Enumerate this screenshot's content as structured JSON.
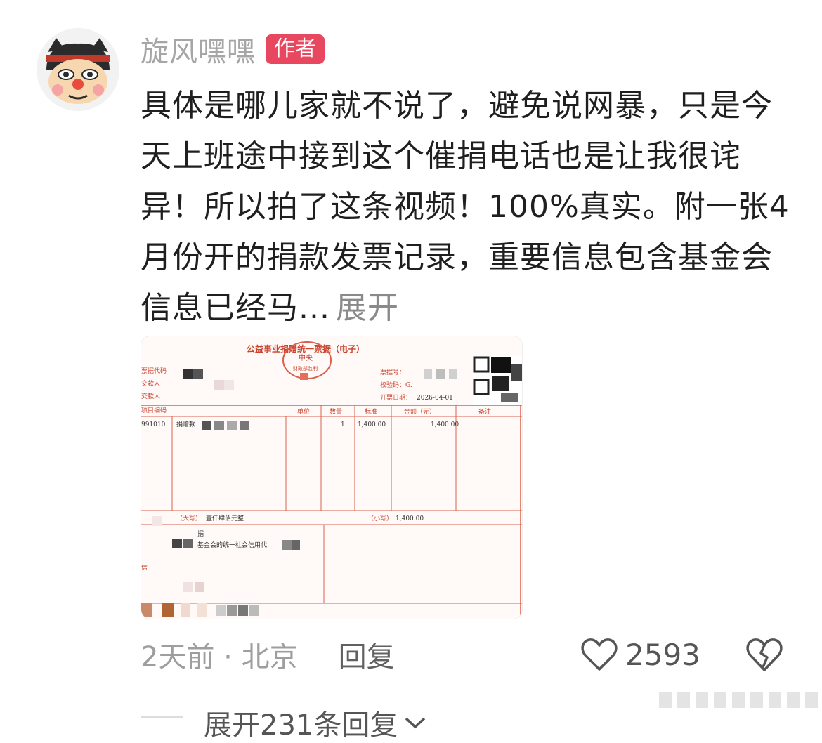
{
  "comment": {
    "username": "旋风嘿嘿",
    "author_badge": "作者",
    "text": "具体是哪儿家就不说了，避免说网暴，只是今天上班途中接到这个催捐电话也是让我很诧异！所以拍了这条视频！100%真实。附一张4月份开的捐款发票记录，重要信息包含基金会信息已经马...",
    "expand_label": "展开",
    "time_location": "2天前 · 北京",
    "reply_label": "回复",
    "like_count": "2593",
    "avatar_icon": "cartoon-mask-avatar"
  },
  "invoice": {
    "title": "公益事业捐赠统一票据（电子）",
    "seal_text": "中央",
    "seal_sub": "财政部监制",
    "left_labels": [
      "票据代码",
      "交款人",
      "交款人",
      "项目编码"
    ],
    "receipt_no_label": "票据号：",
    "check_code_label": "校验码：G.",
    "issue_date_label": "开票日期：",
    "issue_date": "2026-04-01",
    "col_qty": "数量",
    "col_std": "标准",
    "col_amount": "金额（元）",
    "col_note": "备注",
    "col_unit": "单位",
    "row_code": "991010",
    "row_item": "捐赠款",
    "row_qty": "1",
    "row_std": "1,400.00",
    "row_amount": "1,400.00",
    "total_upper_label": "（大写）",
    "total_upper": "壹仟肆佰元整",
    "total_lower_label": "（小写）",
    "total_lower": "1,400.00",
    "note_line1": "据",
    "note_line2": "基金会的统一社会信用代",
    "left_letter": "信"
  },
  "replies": {
    "expand_label": "展开231条回复"
  },
  "colors": {
    "accent": "#e8485f",
    "muted_text": "#a6a6a6",
    "invoice_red": "#c9432f"
  }
}
